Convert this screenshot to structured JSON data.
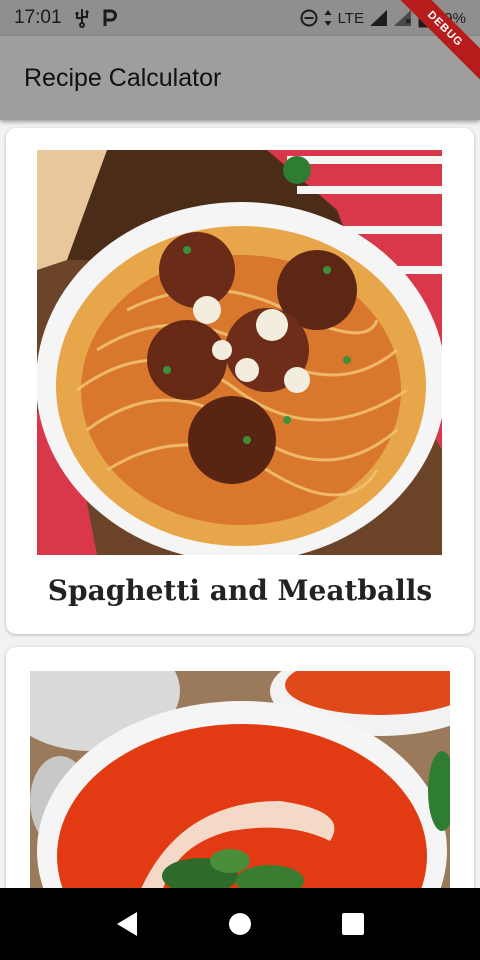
{
  "status_bar": {
    "time": "17:01",
    "left_icons": [
      "usb-icon",
      "parking-icon"
    ],
    "network": "LTE",
    "battery": "99%"
  },
  "debug_banner": "DEBUG",
  "app_bar": {
    "title": "Recipe Calculator"
  },
  "recipes": [
    {
      "title": "Spaghetti and Meatballs",
      "image": "spaghetti-meatballs-photo"
    },
    {
      "title": "",
      "image": "tomato-soup-photo"
    }
  ],
  "nav": {
    "icons": [
      "back-icon",
      "home-icon",
      "recents-icon"
    ]
  },
  "colors": {
    "status_bar": "#8f8f8f",
    "app_bar": "#9e9e9e",
    "background": "#f2f2f2",
    "card": "#ffffff",
    "debug": "#b71c1c"
  }
}
